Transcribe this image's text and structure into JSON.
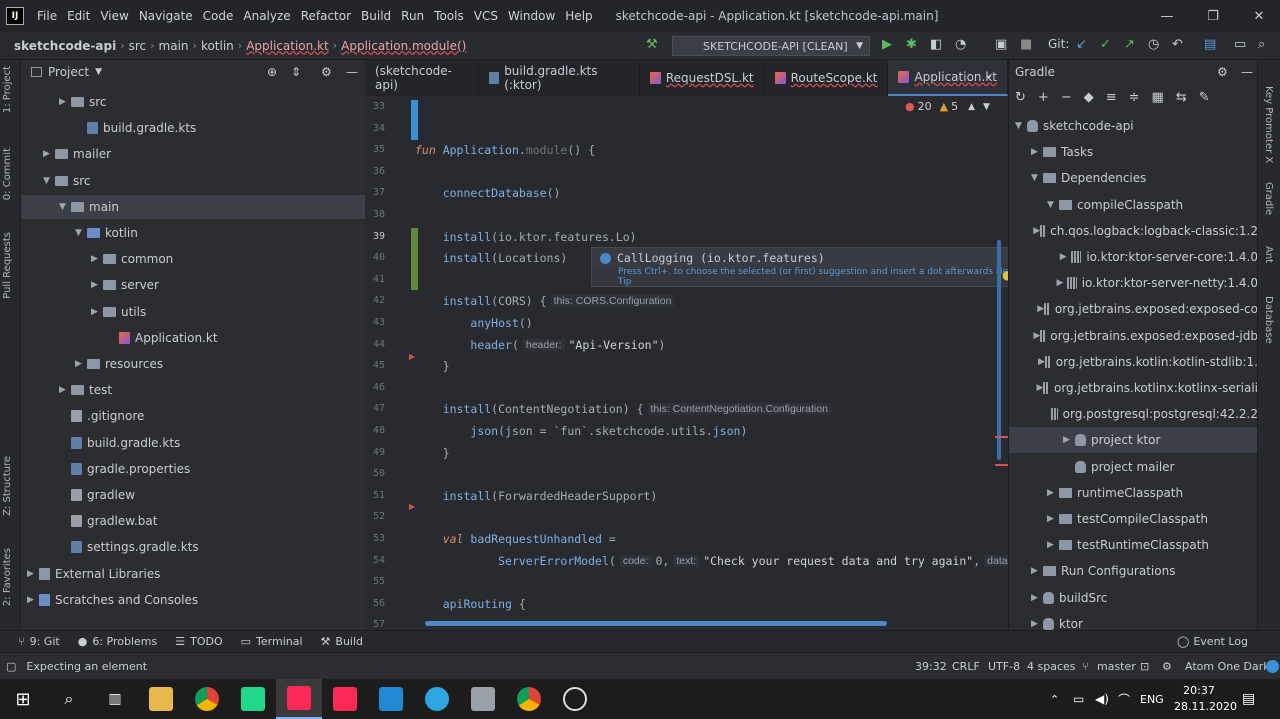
{
  "menubar": {
    "items": [
      "File",
      "Edit",
      "View",
      "Navigate",
      "Code",
      "Analyze",
      "Refactor",
      "Build",
      "Run",
      "Tools",
      "VCS",
      "Window",
      "Help"
    ],
    "title": "sketchcode-api - Application.kt [sketchcode-api.main]",
    "logo": "IJ"
  },
  "breadcrumb": [
    "sketchcode-api",
    "src",
    "main",
    "kotlin",
    "Application.kt",
    "Application.module()"
  ],
  "toolbar": {
    "run_config": "SKETCHCODE-API [CLEAN]",
    "git_label": "Git:"
  },
  "left_tabs": [
    "1: Project",
    "0: Commit",
    "Pull Requests",
    "Z: Structure",
    "2: Favorites"
  ],
  "project_panel": {
    "title": "Project",
    "tree": [
      {
        "label": "src",
        "indent": 2,
        "type": "folder",
        "chev": "▶"
      },
      {
        "label": "build.gradle.kts",
        "indent": 3,
        "type": "gradle",
        "chev": ""
      },
      {
        "label": "mailer",
        "indent": 1,
        "type": "folder",
        "chev": "▶"
      },
      {
        "label": "src",
        "indent": 1,
        "type": "folder",
        "chev": "▼"
      },
      {
        "label": "main",
        "indent": 2,
        "type": "folder",
        "chev": "▼",
        "selected": true
      },
      {
        "label": "kotlin",
        "indent": 3,
        "type": "folder-blue",
        "chev": "▼"
      },
      {
        "label": "common",
        "indent": 4,
        "type": "folder",
        "chev": "▶"
      },
      {
        "label": "server",
        "indent": 4,
        "type": "folder",
        "chev": "▶"
      },
      {
        "label": "utils",
        "indent": 4,
        "type": "folder",
        "chev": "▶"
      },
      {
        "label": "Application.kt",
        "indent": 5,
        "type": "kotlin",
        "chev": ""
      },
      {
        "label": "resources",
        "indent": 3,
        "type": "folder",
        "chev": "▶"
      },
      {
        "label": "test",
        "indent": 2,
        "type": "folder",
        "chev": "▶"
      },
      {
        "label": ".gitignore",
        "indent": 2,
        "type": "file",
        "chev": ""
      },
      {
        "label": "build.gradle.kts",
        "indent": 2,
        "type": "gradle",
        "chev": ""
      },
      {
        "label": "gradle.properties",
        "indent": 2,
        "type": "gradle",
        "chev": ""
      },
      {
        "label": "gradlew",
        "indent": 2,
        "type": "file",
        "chev": ""
      },
      {
        "label": "gradlew.bat",
        "indent": 2,
        "type": "file",
        "chev": ""
      },
      {
        "label": "settings.gradle.kts",
        "indent": 2,
        "type": "gradle",
        "chev": ""
      },
      {
        "label": "External Libraries",
        "indent": 0,
        "type": "lib",
        "chev": "▶"
      },
      {
        "label": "Scratches and Consoles",
        "indent": 0,
        "type": "scratch",
        "chev": "▶"
      }
    ]
  },
  "editor_tabs": [
    {
      "label": "(sketchcode-api)",
      "active": false
    },
    {
      "label": "build.gradle.kts (:ktor)",
      "active": false
    },
    {
      "label": "RequestDSL.kt",
      "active": false
    },
    {
      "label": "RouteScope.kt",
      "active": false
    },
    {
      "label": "Application.kt",
      "active": true
    }
  ],
  "inspections": {
    "errors": "20",
    "warnings": "5"
  },
  "line_numbers": [
    "33",
    "34",
    "35",
    "36",
    "37",
    "38",
    "39",
    "40",
    "41",
    "42",
    "43",
    "44",
    "45",
    "46",
    "47",
    "48",
    "49",
    "50",
    "51",
    "52",
    "53",
    "54",
    "55",
    "56",
    "57"
  ],
  "code_lines": [
    [],
    [],
    [
      [
        "kw",
        "fun "
      ],
      [
        "fn",
        "Application"
      ],
      [
        "pl",
        "."
      ],
      [
        "gray",
        "module"
      ],
      [
        "pl",
        "() {"
      ]
    ],
    [],
    [
      [
        "ind",
        "    "
      ],
      [
        "fn",
        "connectDatabase"
      ],
      [
        "pl",
        "()"
      ]
    ],
    [],
    [
      [
        "ind",
        "    "
      ],
      [
        "fn",
        "install"
      ],
      [
        "pl",
        "(io.ktor.features.Lo)"
      ]
    ],
    [
      [
        "ind",
        "    "
      ],
      [
        "fn",
        "install"
      ],
      [
        "pl",
        "(Locations)"
      ]
    ],
    [],
    [
      [
        "ind",
        "    "
      ],
      [
        "fn",
        "install"
      ],
      [
        "pl",
        "(CORS) {"
      ],
      [
        "hint",
        "this: CORS.Configuration"
      ]
    ],
    [
      [
        "ind",
        "        "
      ],
      [
        "fn",
        "anyHost"
      ],
      [
        "pl",
        "()"
      ]
    ],
    [
      [
        "ind",
        "        "
      ],
      [
        "fn",
        "header"
      ],
      [
        "pl",
        "("
      ],
      [
        "hint",
        "header:"
      ],
      [
        "str",
        "\"Api-Version\""
      ],
      [
        "pl",
        ")"
      ]
    ],
    [
      [
        "ind",
        "    "
      ],
      [
        "pl",
        "}"
      ]
    ],
    [],
    [
      [
        "ind",
        "    "
      ],
      [
        "fn",
        "install"
      ],
      [
        "pl",
        "(ContentNegotiation) {"
      ],
      [
        "hint",
        "this: ContentNegotiation.Configuration"
      ]
    ],
    [
      [
        "ind",
        "        "
      ],
      [
        "fn",
        "json"
      ],
      [
        "pl",
        "(json = `fun`.sketchcode.utils."
      ],
      [
        "fn",
        "json"
      ],
      [
        "pl",
        ")"
      ]
    ],
    [
      [
        "ind",
        "    "
      ],
      [
        "pl",
        "}"
      ]
    ],
    [],
    [
      [
        "ind",
        "    "
      ],
      [
        "fn",
        "install"
      ],
      [
        "pl",
        "(ForwardedHeaderSupport)"
      ]
    ],
    [],
    [
      [
        "ind",
        "    "
      ],
      [
        "kw",
        "val "
      ],
      [
        "fn",
        "badRequestUnhandled"
      ],
      [
        "pl",
        " ="
      ]
    ],
    [
      [
        "ind",
        "            "
      ],
      [
        "fn",
        "ServerErrorModel"
      ],
      [
        "pl",
        "("
      ],
      [
        "hint",
        "code:"
      ],
      [
        "pl",
        "0,"
      ],
      [
        "hint",
        "text:"
      ],
      [
        "str",
        "\"Check your request data and try again\""
      ],
      [
        "pl",
        ","
      ],
      [
        "hint",
        "data:"
      ]
    ],
    [],
    [
      [
        "ind",
        "    "
      ],
      [
        "fn",
        "apiRouting"
      ],
      [
        "pl",
        " {"
      ]
    ],
    []
  ],
  "completion": {
    "item": "CallLogging (io.ktor.features)",
    "tip": "Press Ctrl+. to choose the selected (or first) suggestion and insert a dot afterwards  Next Tip"
  },
  "gradle_panel": {
    "title": "Gradle",
    "tree": [
      {
        "label": "sketchcode-api",
        "indent": 0,
        "chev": "▼",
        "type": "elephant"
      },
      {
        "label": "Tasks",
        "indent": 1,
        "chev": "▶",
        "type": "folder"
      },
      {
        "label": "Dependencies",
        "indent": 1,
        "chev": "▼",
        "type": "folder"
      },
      {
        "label": "compileClasspath",
        "indent": 2,
        "chev": "▼",
        "type": "folder"
      },
      {
        "label": "ch.qos.logback:logback-classic:1.2",
        "indent": 3,
        "chev": "▶",
        "type": "lib"
      },
      {
        "label": "io.ktor:ktor-server-core:1.4.0",
        "indent": 3,
        "chev": "▶",
        "type": "lib"
      },
      {
        "label": "io.ktor:ktor-server-netty:1.4.0",
        "indent": 3,
        "chev": "▶",
        "type": "lib"
      },
      {
        "label": "org.jetbrains.exposed:exposed-co",
        "indent": 3,
        "chev": "▶",
        "type": "lib"
      },
      {
        "label": "org.jetbrains.exposed:exposed-jdb",
        "indent": 3,
        "chev": "▶",
        "type": "lib"
      },
      {
        "label": "org.jetbrains.kotlin:kotlin-stdlib:1.",
        "indent": 3,
        "chev": "▶",
        "type": "lib"
      },
      {
        "label": "org.jetbrains.kotlinx:kotlinx-seriali",
        "indent": 3,
        "chev": "▶",
        "type": "lib"
      },
      {
        "label": "org.postgresql:postgresql:42.2.2",
        "indent": 3,
        "chev": "",
        "type": "lib"
      },
      {
        "label": "project ktor",
        "indent": 3,
        "chev": "▶",
        "type": "elephant",
        "selected": true
      },
      {
        "label": "project mailer",
        "indent": 3,
        "chev": "",
        "type": "elephant"
      },
      {
        "label": "runtimeClasspath",
        "indent": 2,
        "chev": "▶",
        "type": "folder"
      },
      {
        "label": "testCompileClasspath",
        "indent": 2,
        "chev": "▶",
        "type": "folder"
      },
      {
        "label": "testRuntimeClasspath",
        "indent": 2,
        "chev": "▶",
        "type": "folder"
      },
      {
        "label": "Run Configurations",
        "indent": 1,
        "chev": "▶",
        "type": "folder"
      },
      {
        "label": "buildSrc",
        "indent": 1,
        "chev": "▶",
        "type": "elephant"
      },
      {
        "label": "ktor",
        "indent": 1,
        "chev": "▶",
        "type": "elephant"
      }
    ]
  },
  "right_tabs": [
    "Key Promoter X",
    "Gradle",
    "Ant",
    "Database"
  ],
  "bottom_tools": [
    {
      "icon": "git-icon",
      "label": "9: Git"
    },
    {
      "icon": "problems-icon",
      "label": "6: Problems"
    },
    {
      "icon": "todo-icon",
      "label": "TODO"
    },
    {
      "icon": "terminal-icon",
      "label": "Terminal"
    },
    {
      "icon": "build-icon",
      "label": "Build"
    }
  ],
  "event_log": "Event Log",
  "status": {
    "message": "Expecting an element",
    "position": "39:32",
    "line_sep": "CRLF",
    "encoding": "UTF-8",
    "indent": "4 spaces",
    "branch": "master",
    "theme": "Atom One Dark"
  },
  "taskbar": {
    "time": "20:37",
    "date": "28.11.2020",
    "lang": "ENG"
  }
}
